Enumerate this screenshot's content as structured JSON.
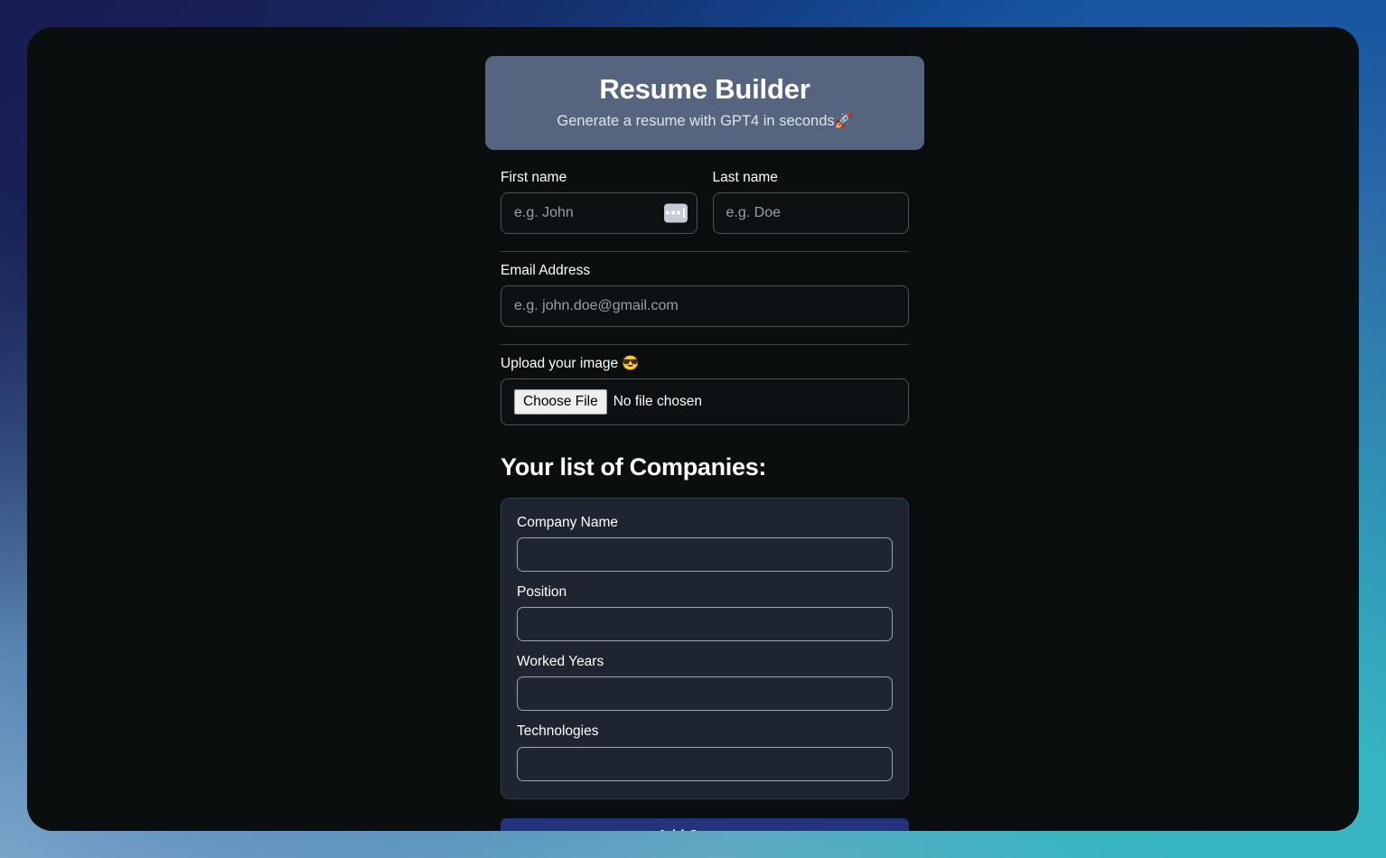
{
  "header": {
    "title": "Resume Builder",
    "subtitle": "Generate a resume with GPT4 in seconds",
    "rocket_emoji": "🚀",
    "background_color": "#56647f"
  },
  "form": {
    "first_name": {
      "label": "First name",
      "placeholder": "e.g. John",
      "value": "",
      "autofill_icon": "autofill-dots-icon"
    },
    "last_name": {
      "label": "Last name",
      "placeholder": "e.g. Doe",
      "value": ""
    },
    "email": {
      "label": "Email Address",
      "placeholder": "e.g. john.doe@gmail.com",
      "value": ""
    },
    "upload": {
      "label": "Upload your image",
      "emoji": "😎",
      "button_label": "Choose File",
      "status_text": "No file chosen"
    }
  },
  "companies": {
    "heading": "Your list of Companies:",
    "card_background": "#1e2430",
    "fields": [
      {
        "label": "Company Name",
        "value": ""
      },
      {
        "label": "Position",
        "value": ""
      },
      {
        "label": "Worked Years",
        "value": ""
      },
      {
        "label": "Technologies",
        "value": ""
      }
    ],
    "add_button": {
      "label": "Add Company",
      "color": "#23337e"
    }
  },
  "theme": {
    "panel_background": "#0a0e0e",
    "page_gradient_start": "#181e52",
    "page_gradient_mid": "#13509e",
    "page_gradient_end": "#36b5c2"
  }
}
